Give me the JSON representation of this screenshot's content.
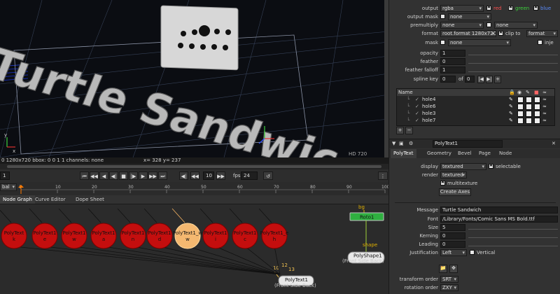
{
  "viewer": {
    "scene_text": "Turtle Sandwic",
    "hd_label": "HD 720",
    "status_left": "0 1280x720 bbox: 0 0 1 1 channels: none",
    "status_right": "x= 328 y= 237",
    "axis_y": "y",
    "axis_x": "x"
  },
  "transport": {
    "frame": "10",
    "fps_label": "fps",
    "fps_value": "24",
    "frame_left": "1",
    "view_mode": "bal"
  },
  "timeline": {
    "ticks": [
      "1",
      "10",
      "20",
      "30",
      "40",
      "50",
      "60",
      "70",
      "80",
      "90",
      "100"
    ],
    "right_value": "100",
    "current_frame_fraction": 0.0
  },
  "node_graph": {
    "tabs": [
      "Node Graph",
      "Curve Editor",
      "Dope Sheet"
    ],
    "red_nodes": [
      {
        "name": "PolyText",
        "sub": "k"
      },
      {
        "name": "PolyText1",
        "sub": "e"
      },
      {
        "name": "PolyText1",
        "sub": "w"
      },
      {
        "name": "PolyText1",
        "sub": "a"
      },
      {
        "name": "PolyText1",
        "sub": "n"
      },
      {
        "name": "PolyText1",
        "sub": "d"
      },
      {
        "name": "PolyText1",
        "sub": "i"
      },
      {
        "name": "PolyText1",
        "sub": "c"
      },
      {
        "name": "PolyText1_e",
        "sub": "h"
      }
    ],
    "selected_node": {
      "name": "PolyText1_w",
      "sub": "w"
    },
    "roto": {
      "name": "Roto1",
      "input": "bg",
      "output": "shape"
    },
    "polyshape": {
      "name": "PolyShape1",
      "sub": "(Front Side Back)"
    },
    "polytext": {
      "name": "PolyText1",
      "sub": "(Front Side Back)"
    },
    "port_labels": [
      "10",
      "12",
      "13"
    ]
  },
  "props": {
    "output": {
      "label": "output",
      "value": "rgba",
      "checks": [
        "red",
        "green",
        "blue"
      ]
    },
    "output_mask": {
      "label": "output mask",
      "value": "none"
    },
    "premultiply": {
      "label": "premultiply",
      "value": "none",
      "extra": "none"
    },
    "format": {
      "label": "format",
      "value": "root.format 1280x720",
      "clip_label": "clip to",
      "clip_value": "format"
    },
    "mask": {
      "label": "mask",
      "value": "none",
      "extra": "inje"
    },
    "opacity": {
      "label": "opacity",
      "value": "1"
    },
    "feather": {
      "label": "feather",
      "value": "0"
    },
    "feather_falloff": {
      "label": "feather falloff",
      "value": "1"
    },
    "spline_key": {
      "label": "spline key",
      "value": "0",
      "of": "of",
      "of_value": "0"
    },
    "layer_table": {
      "header": "Name",
      "rows": [
        "hole4",
        "hole6",
        "hole3",
        "hole7"
      ]
    },
    "node_name": "PolyText1",
    "tabs": [
      "PolyText",
      "Geometry",
      "Bevel",
      "Page",
      "Node"
    ],
    "display": {
      "label": "display",
      "value": "textured",
      "check_label": "selectable"
    },
    "render": {
      "label": "render",
      "value": "textured",
      "check_label": "multitexture"
    },
    "create_axes": "Create Axes",
    "message": {
      "label": "Message",
      "value": "Turtle Sandwich"
    },
    "font": {
      "label": "Font",
      "value": "/Library/Fonts/Comic Sans MS Bold.ttf"
    },
    "size": {
      "label": "Size",
      "value": "5"
    },
    "kerning": {
      "label": "Kerning",
      "value": "0"
    },
    "leading": {
      "label": "Leading",
      "value": "0"
    },
    "justification": {
      "label": "Justification",
      "value": "Left",
      "check_label": "Vertical"
    },
    "transform_order": {
      "label": "transform order",
      "value": "SRT"
    },
    "rotation_order": {
      "label": "rotation order",
      "value": "ZXY"
    }
  }
}
